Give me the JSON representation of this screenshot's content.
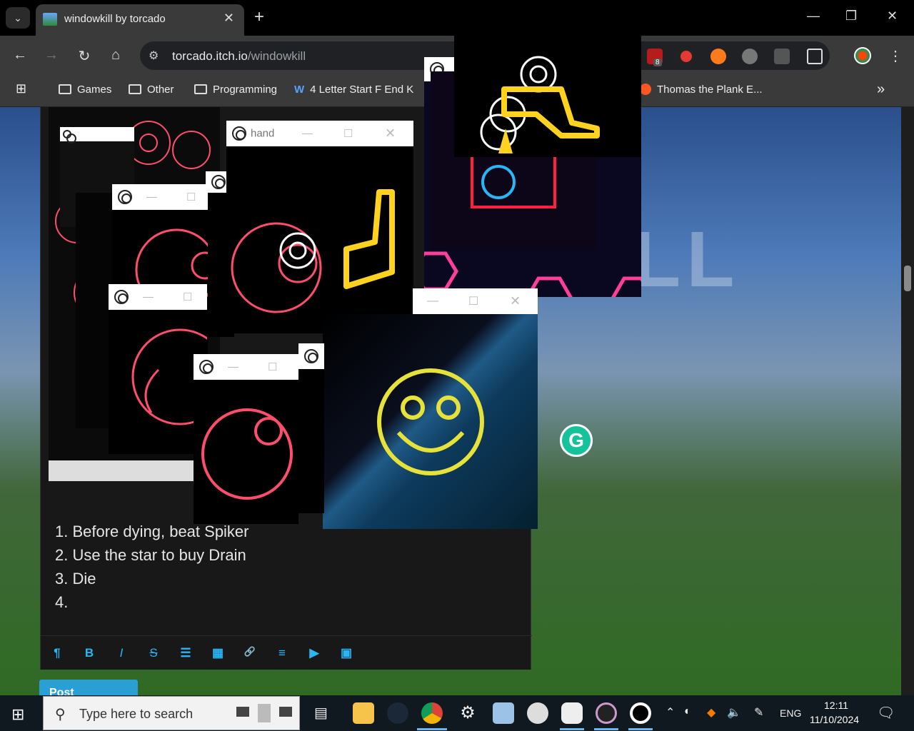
{
  "browser": {
    "tab_title": "windowkill by torcado",
    "tab_close": "✕",
    "new_tab": "+",
    "tab_menu": "⌄",
    "window_controls": {
      "minimize": "—",
      "maximize": "❐",
      "close": "✕"
    },
    "nav": {
      "back": "←",
      "forward": "→",
      "reload": "↻",
      "home": "⌂"
    },
    "url_host": "torcado.itch.io",
    "url_path": "/windowkill",
    "ublock_badge": "8",
    "bookmarks": [
      {
        "label": "Games"
      },
      {
        "label": "Other"
      },
      {
        "label": "Programming"
      },
      {
        "label": "4 Letter Start F End K"
      },
      {
        "label": "Thomas the Plank E..."
      }
    ],
    "bookmarks_more": "»"
  },
  "page": {
    "editor_list": [
      "1. Before dying, beat Spiker",
      "2. Use the star to buy Drain",
      "3. Die",
      "4."
    ],
    "editor_tools": [
      "¶",
      "B",
      "I",
      "S",
      "☰",
      "▦",
      "🔗",
      "≡",
      "▶",
      "▣"
    ],
    "post_comment": "Post comment",
    "blur_title": "KILL"
  },
  "game_windows": {
    "hand_label": "hand",
    "btn_min": "—",
    "btn_max": "☐",
    "btn_close": "✕"
  },
  "taskbar": {
    "start": "⊞",
    "search_placeholder": "Type here to search",
    "tray_lang": "ENG",
    "time": "12:11",
    "date": "11/10/2024"
  },
  "colors": {
    "accent_blue": "#2a9fd6",
    "enemy_pink": "#ff4d6d",
    "hex_pink": "#ff3d9a",
    "player_yellow": "#ffd21f",
    "smiley_yellow": "#e6e23a"
  }
}
